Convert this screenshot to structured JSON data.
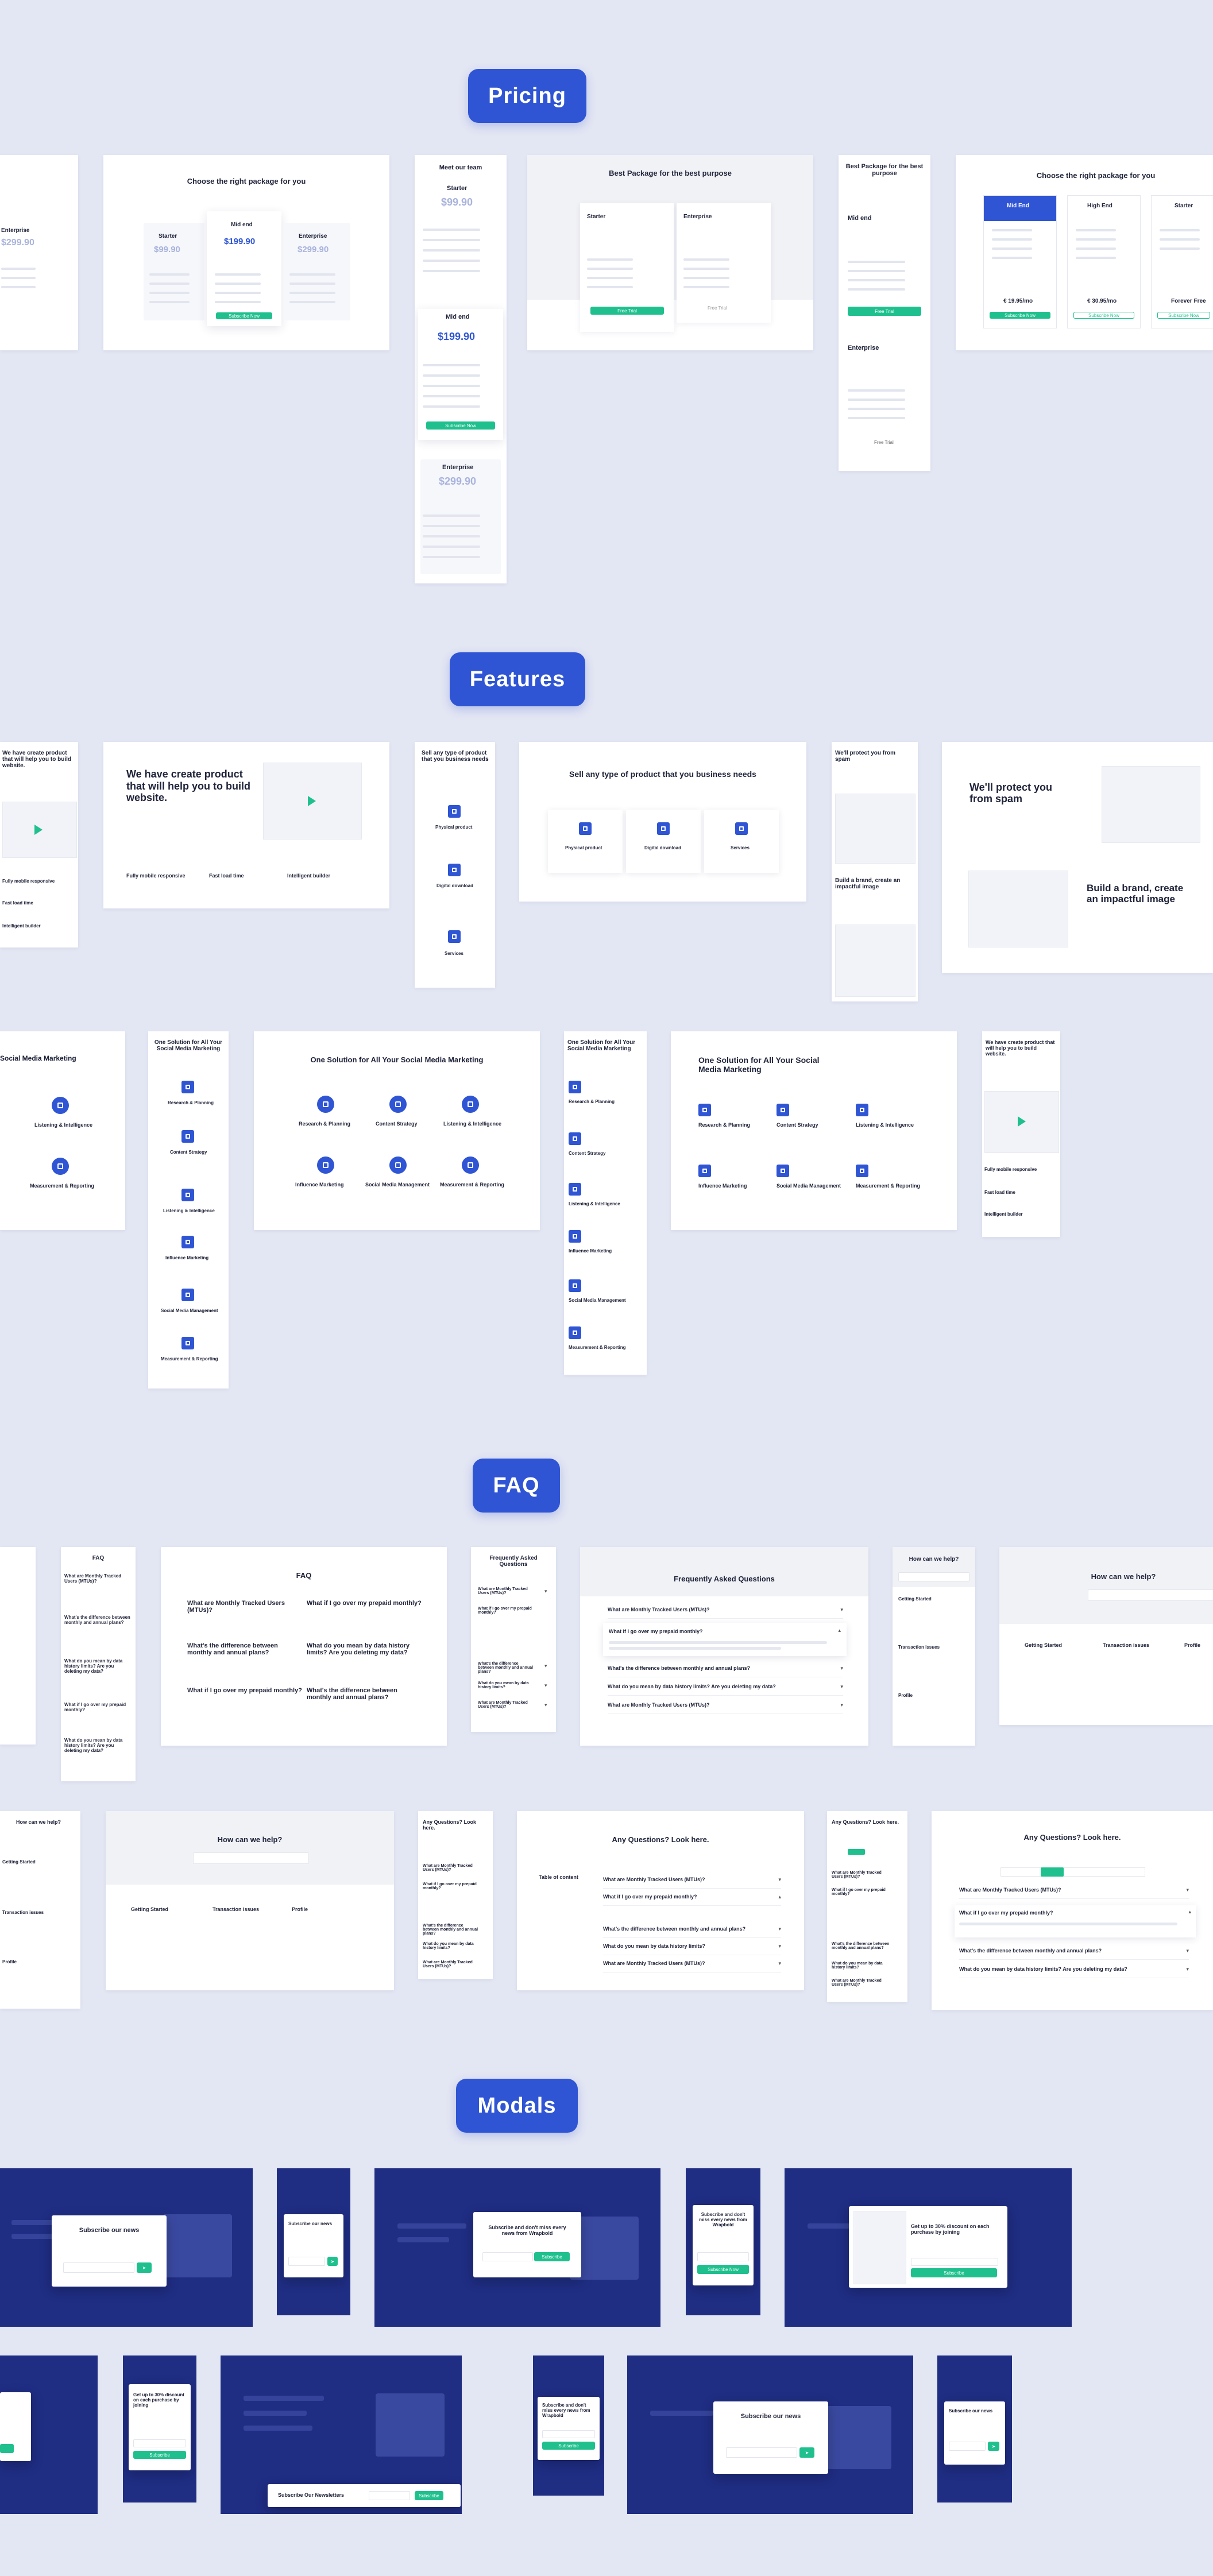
{
  "sections": {
    "pricing": "Pricing",
    "features": "Features",
    "faq": "FAQ",
    "modals": "Modals"
  },
  "pricing": {
    "heading": "Choose the right package for you",
    "meet_team": "Meet our team",
    "best_package": "Best Package for the best purpose",
    "best_package_short": "Best Package for the best purpose",
    "starter": "Starter",
    "mid_end": "Mid end",
    "mid_end_cap": "Mid End",
    "high_end": "High End",
    "enterprise": "Enterprise",
    "price_starter": "$99.90",
    "price_mid": "$199.90",
    "price_ent": "$299.90",
    "price_euro_1": "€ 19.95/mo",
    "price_euro_2": "€ 30.95/mo",
    "forever_free": "Forever Free",
    "subscribe_now": "Subscribe Now",
    "free_trial": "Free Trial"
  },
  "features": {
    "we_have_create": "We have create product that will help you to build website.",
    "fully_mobile": "Fully mobile responsive",
    "fast_load": "Fast load time",
    "intelligent": "Intelligent builder",
    "sell_any": "Sell any type of product that you business needs",
    "physical": "Physical product",
    "digital": "Digital download",
    "services": "Services",
    "protect": "We'll protect you from spam",
    "brand": "Build a brand, create an impactful image",
    "one_solution": "One Solution for All Your Social Media Marketing",
    "one_solution_short": "Social Media Marketing",
    "research": "Research & Planning",
    "content": "Content Strategy",
    "listening": "Listening & Intelligence",
    "influence": "Influence Marketing",
    "smm": "Social Media Management",
    "measure": "Measurement & Reporting"
  },
  "faq": {
    "faq_title": "FAQ",
    "faq_long": "Frequently Asked Questions",
    "help": "How can we help?",
    "any_q": "Any Questions? Look here.",
    "q1": "What are Monthly Tracked Users (MTUs)?",
    "q2": "What if I go over my prepaid monthly?",
    "q3": "What's the difference between monthly and annual plans?",
    "q4": "What do you mean by data history limits? Are you deleting my data?",
    "q5": "What do you mean by data history limits?",
    "getting_started": "Getting Started",
    "transaction": "Transaction issues",
    "profile": "Profile",
    "toc": "Table of content"
  },
  "modals": {
    "subscribe_news": "Subscribe our news",
    "subscribe_miss": "Subscribe and don't miss every news from Wrapbold",
    "discount": "Get up to 30% discount on each purchase by joining",
    "newsletters": "Subscribe Our Newsletters",
    "subscribe": "Subscribe",
    "subscribe_now": "Subscribe Now"
  }
}
